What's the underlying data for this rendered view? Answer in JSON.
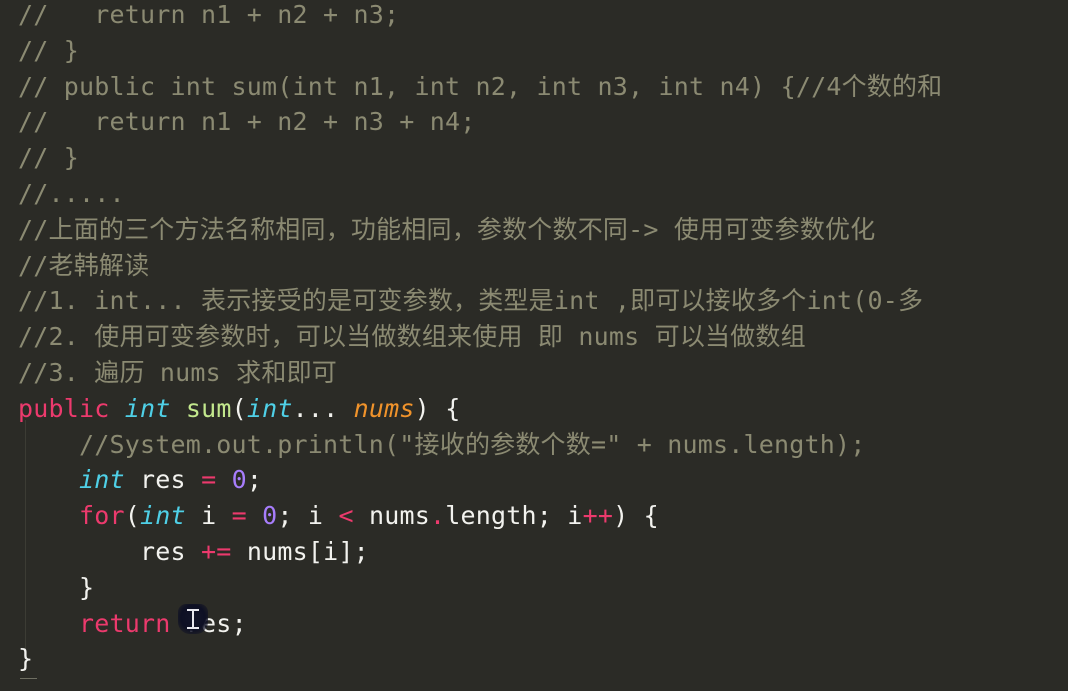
{
  "editor": {
    "language": "java",
    "background_color": "#2b2b26",
    "comment_color": "#8b8a72",
    "keyword_color": "#ec3a6d",
    "type_color": "#4fd0e7",
    "method_color": "#c3e88d",
    "parameter_color": "#f0932b",
    "number_color": "#a77dfb",
    "plain_text_color": "#f2f2ee",
    "cursor_icon": "i-beam-text-cursor",
    "lines": [
      {
        "id": 1,
        "text": "//   return n1 + n2 + n3;"
      },
      {
        "id": 2,
        "text": "// }"
      },
      {
        "id": 3,
        "text": "// public int sum(int n1, int n2, int n3, int n4) {//4个数的和"
      },
      {
        "id": 4,
        "text": "//   return n1 + n2 + n3 + n4;"
      },
      {
        "id": 5,
        "text": "// }"
      },
      {
        "id": 6,
        "text": "//....."
      },
      {
        "id": 7,
        "text": "//上面的三个方法名称相同，功能相同，参数个数不同-> 使用可变参数优化"
      },
      {
        "id": 8,
        "text": "//老韩解读"
      },
      {
        "id": 9,
        "text": "//1. int... 表示接受的是可变参数，类型是int ,即可以接收多个int(0-多"
      },
      {
        "id": 10,
        "text": "//2. 使用可变参数时，可以当做数组来使用 即 nums 可以当做数组"
      },
      {
        "id": 11,
        "text": "//3. 遍历 nums 求和即可"
      },
      {
        "id": 12,
        "text": "public int sum(int... nums) {"
      },
      {
        "id": 13,
        "text": "    //System.out.println(\"接收的参数个数=\" + nums.length);"
      },
      {
        "id": 14,
        "text": "    int res = 0;"
      },
      {
        "id": 15,
        "text": "    for(int i = 0; i < nums.length; i++) {"
      },
      {
        "id": 16,
        "text": "        res += nums[i];"
      },
      {
        "id": 17,
        "text": "    }"
      },
      {
        "id": 18,
        "text": "    return res;"
      },
      {
        "id": 19,
        "text": "}"
      }
    ],
    "tokens": {
      "l1": {
        "comment": "//   return n1 + n2 + n3;"
      },
      "l2": {
        "comment": "// }"
      },
      "l3": {
        "comment": "// public int sum(int n1, int n2, int n3, int n4) {//4个数的和"
      },
      "l4": {
        "comment": "//   return n1 + n2 + n3 + n4;"
      },
      "l5": {
        "comment": "// }"
      },
      "l6": {
        "comment": "//....."
      },
      "l7": {
        "comment": "//上面的三个方法名称相同，功能相同，参数个数不同-> 使用可变参数优化"
      },
      "l8": {
        "comment": "//老韩解读"
      },
      "l9": {
        "comment": "//1. int... 表示接受的是可变参数，类型是int ,即可以接收多个int(0-多"
      },
      "l10": {
        "comment": "//2. 使用可变参数时，可以当做数组来使用 即 nums 可以当做数组"
      },
      "l11": {
        "comment": "//3. 遍历 nums 求和即可"
      },
      "l12": {
        "kw_public": "public",
        "sp1": " ",
        "type_int": "int",
        "sp2": " ",
        "fn_sum": "sum",
        "paren_open": "(",
        "type_int2": "int",
        "ellipsis": "...",
        "sp3": " ",
        "param_nums": "nums",
        "paren_close": ")",
        "sp4": " ",
        "brace_open": "{"
      },
      "l13": {
        "indent": "    ",
        "comment": "//System.out.println(\"接收的参数个数=\" + nums.length);"
      },
      "l14": {
        "indent": "    ",
        "type_int": "int",
        "sp1": " ",
        "var_res": "res",
        "sp2": " ",
        "op_assign": "=",
        "sp3": " ",
        "num_zero": "0",
        "semi": ";"
      },
      "l15": {
        "indent": "    ",
        "kw_for": "for",
        "paren_open": "(",
        "type_int": "int",
        "sp1": " ",
        "var_i": "i",
        "sp2": " ",
        "op_assign": "=",
        "sp3": " ",
        "num_zero": "0",
        "semi1": "; ",
        "var_i2": "i",
        "sp4": " ",
        "op_lt": "<",
        "sp5": " ",
        "var_nums": "nums",
        "dot": ".",
        "prop_length": "length",
        "semi2": "; ",
        "var_i3": "i",
        "op_inc": "++",
        "paren_close": ")",
        "sp6": " ",
        "brace_open": "{"
      },
      "l16": {
        "indent": "        ",
        "var_res": "res",
        "sp1": " ",
        "op_plus_assign": "+=",
        "sp2": " ",
        "var_nums": "nums",
        "bracket_open": "[",
        "var_i": "i",
        "bracket_close": "]",
        "semi": ";"
      },
      "l17": {
        "indent": "    ",
        "brace_close": "}"
      },
      "l18": {
        "indent": "    ",
        "kw_return": "return",
        "sp1": " ",
        "var_res": "res",
        "semi": ";"
      },
      "l19": {
        "brace_close": "}"
      }
    }
  }
}
